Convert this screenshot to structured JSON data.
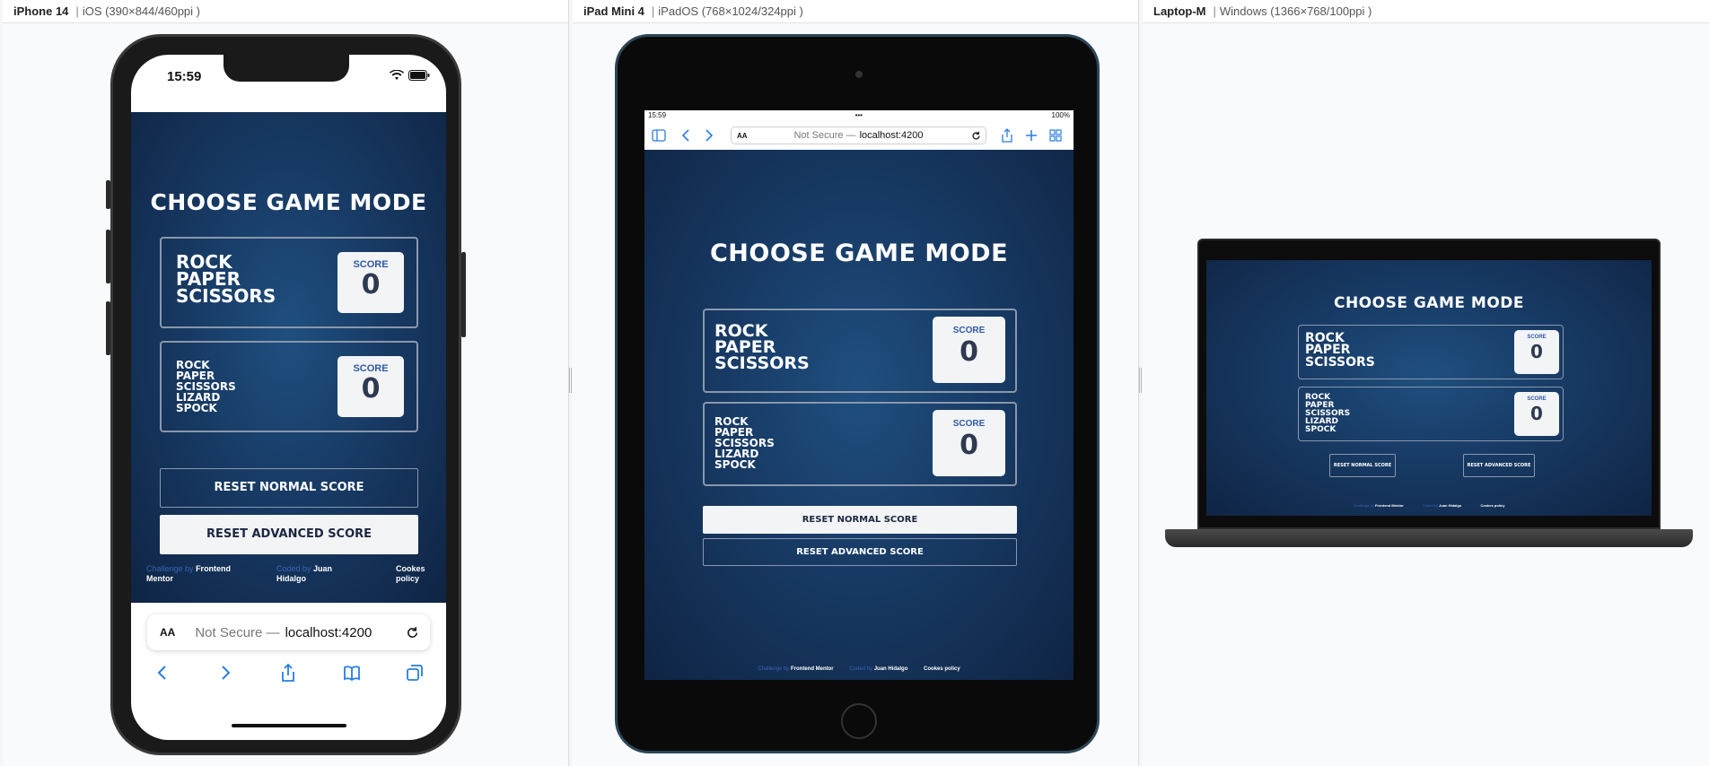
{
  "panels": [
    {
      "device": "iPhone 14",
      "spec": "iOS (390×844/460ppi )"
    },
    {
      "device": "iPad Mini 4",
      "spec": "iPadOS (768×1024/324ppi )"
    },
    {
      "device": "Laptop-M",
      "spec": "Windows (1366×768/100ppi )"
    }
  ],
  "game": {
    "title": "CHOOSE GAME MODE",
    "normal_mode": [
      "ROCK",
      "PAPER",
      "SCISSORS"
    ],
    "advanced_mode": [
      "ROCK",
      "PAPER",
      "SCISSORS",
      "LIZARD",
      "SPOCK"
    ],
    "score_label": "SCORE",
    "normal_score": "0",
    "advanced_score": "0",
    "reset_normal": "RESET NORMAL SCORE",
    "reset_advanced": "RESET ADVANCED SCORE"
  },
  "footer": {
    "challenge_prefix": "Challenge by",
    "challenge_name": "Frontend Mentor",
    "coded_prefix": "Coded by",
    "coded_name": "Juan Hidalgo",
    "cookies": "Cookes policy"
  },
  "phone": {
    "time": "15:59",
    "aa": "AA",
    "url_prefix": "Not Secure —",
    "url": "localhost:4200"
  },
  "ipad": {
    "time": "15:59",
    "battery": "100%",
    "aa": "AA",
    "url_prefix": "Not Secure —",
    "url": "localhost:4200"
  },
  "icons": [
    "wifi-icon",
    "battery-icon",
    "reload-icon",
    "back-icon",
    "forward-icon",
    "share-icon",
    "bookmarks-icon",
    "tabs-icon",
    "sidebar-icon",
    "add-tab-icon"
  ],
  "colors": {
    "bg_dark": "#0f2444",
    "bg_mid": "#1f4f7f",
    "score_label": "#2f5aa8",
    "link_blue": "#2a7de1"
  }
}
